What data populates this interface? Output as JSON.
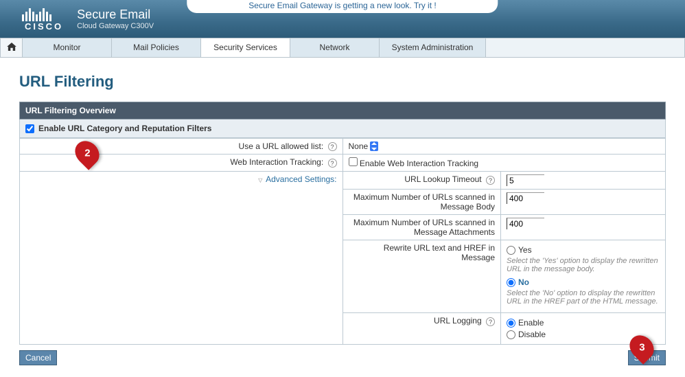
{
  "header": {
    "brand": "CISCO",
    "product_name": "Secure Email",
    "product_sub": "Cloud Gateway C300V",
    "announcement": "Secure Email Gateway is getting a new look. Try it !"
  },
  "nav": {
    "items": [
      "Monitor",
      "Mail Policies",
      "Security Services",
      "Network",
      "System Administration"
    ],
    "active_index": 2
  },
  "page": {
    "title": "URL Filtering",
    "panel_header": "URL Filtering Overview",
    "enable_checkbox_label": "Enable URL Category and Reputation Filters"
  },
  "rows": {
    "allowed_list": {
      "label": "Use a URL allowed list:",
      "value": "None"
    },
    "web_tracking": {
      "label": "Web Interaction Tracking:",
      "checkbox_label": "Enable Web Interaction Tracking"
    },
    "advanced": {
      "label": "Advanced Settings:"
    },
    "lookup_timeout": {
      "label": "URL Lookup Timeout",
      "value": "5"
    },
    "max_urls_body": {
      "label": "Maximum Number of URLs scanned in Message Body",
      "value": "400"
    },
    "max_urls_attach": {
      "label": "Maximum Number of URLs scanned in Message Attachments",
      "value": "400"
    },
    "rewrite": {
      "label": "Rewrite URL text and HREF in Message",
      "yes": "Yes",
      "yes_hint": "Select the 'Yes' option to display the rewritten URL in the message body.",
      "no": "No",
      "no_hint": "Select the 'No' option to display the rewritten URL in the HREF part of the HTML message."
    },
    "logging": {
      "label": "URL Logging",
      "enable": "Enable",
      "disable": "Disable"
    }
  },
  "buttons": {
    "cancel": "Cancel",
    "submit": "Submit"
  },
  "annotations": {
    "two": "2",
    "three": "3"
  }
}
